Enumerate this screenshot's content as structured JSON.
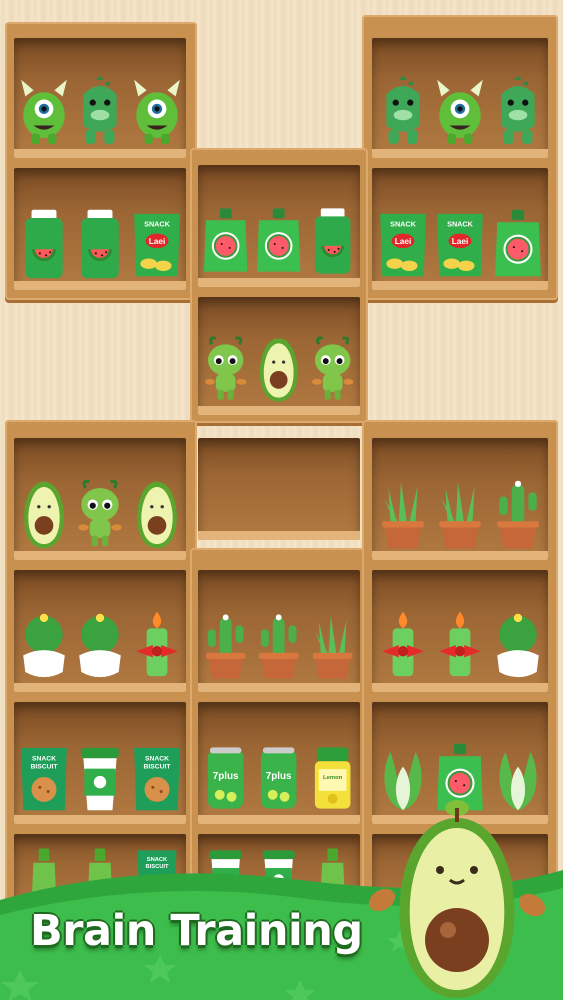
{
  "game": {
    "title": "Brain Training",
    "theme_colors": {
      "green": "#36b24a",
      "dark_green": "#1e6b1f",
      "wood": "#c8914f"
    }
  },
  "shelves": [
    {
      "id": "top-left",
      "rows": [
        [
          "monster-horned",
          "dino",
          "monster-horned"
        ],
        [
          "juice-bottle",
          "juice-bottle",
          "snack-bag"
        ]
      ]
    },
    {
      "id": "top-right",
      "rows": [
        [
          "dino",
          "monster-horned",
          "dino"
        ],
        [
          "snack-bag",
          "snack-bag",
          "juice-pouch"
        ]
      ]
    },
    {
      "id": "top-center",
      "rows": [
        [
          "juice-pouch",
          "juice-pouch",
          "juice-bottle"
        ],
        [
          "alien-sprout",
          "avocado",
          "alien-sprout"
        ]
      ]
    }
  ],
  "labels": {
    "snack": "SNACK",
    "laei": "Laei",
    "snack_biscuit_line1": "SNACK",
    "snack_biscuit_line2": "BISCUIT",
    "can_brand": "7plus",
    "lemon_brand": "Lemon"
  }
}
